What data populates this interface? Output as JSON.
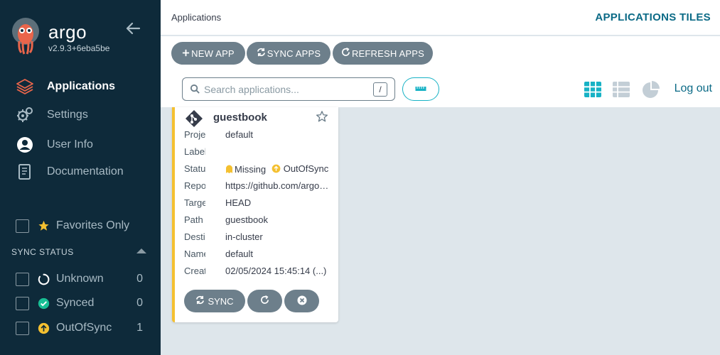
{
  "sidebar": {
    "brand": "argo",
    "version": "v2.9.3+6eba5be",
    "nav": [
      {
        "label": "Applications",
        "icon": "layers-icon",
        "active": true
      },
      {
        "label": "Settings",
        "icon": "gears-icon",
        "active": false
      },
      {
        "label": "User Info",
        "icon": "user-circle-icon",
        "active": false
      },
      {
        "label": "Documentation",
        "icon": "book-icon",
        "active": false
      }
    ],
    "favorites_label": "Favorites Only",
    "sync_status_title": "SYNC STATUS",
    "sync_status": [
      {
        "label": "Unknown",
        "count": "0",
        "icon": "circle-notch-icon"
      },
      {
        "label": "Synced",
        "count": "0",
        "icon": "check-circle-icon"
      },
      {
        "label": "OutOfSync",
        "count": "1",
        "icon": "arrow-up-circle-icon"
      }
    ]
  },
  "header": {
    "title": "Applications",
    "view_title": "APPLICATIONS TILES"
  },
  "toolbar": {
    "new_app": "NEW APP",
    "sync_apps": "SYNC APPS",
    "refresh_apps": "REFRESH APPS",
    "search_placeholder": "Search applications...",
    "search_shortcut": "/",
    "logout": "Log out"
  },
  "app_card": {
    "name": "guestbook",
    "rows": [
      {
        "key": "Project",
        "value": "default"
      },
      {
        "key": "Labels",
        "value": ""
      },
      {
        "key": "Status",
        "value": ""
      },
      {
        "key": "Repository",
        "value": "https://github.com/argoproj/argocd-example-apps.git"
      },
      {
        "key": "Target Revision",
        "value": "HEAD"
      },
      {
        "key": "Path",
        "value": "guestbook"
      },
      {
        "key": "Destination",
        "value": "in-cluster"
      },
      {
        "key": "Namespace",
        "value": "default"
      },
      {
        "key": "Created At",
        "value": "02/05/2024 15:45:14  (...)"
      }
    ],
    "health_status": "Missing",
    "sync_status": "OutOfSync",
    "sync_button": "SYNC"
  },
  "colors": {
    "sidebar_bg": "#0e2a3a",
    "accent": "#0b6a86",
    "button_grey": "#6d7f8b",
    "card_border": "#f4c030",
    "synced_green": "#18be94",
    "out_of_sync_yellow": "#f4c030"
  }
}
